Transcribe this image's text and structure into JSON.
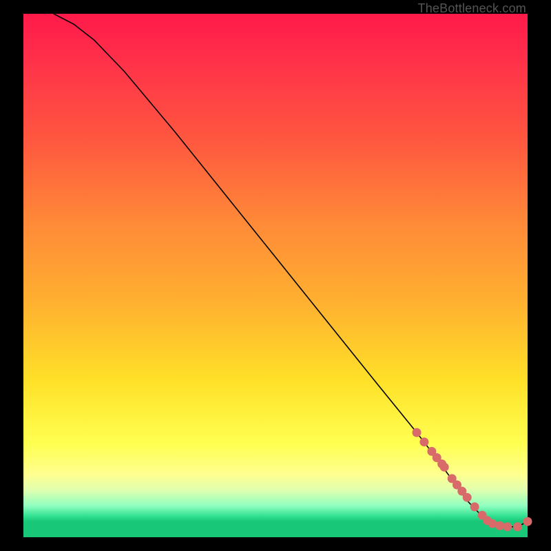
{
  "watermark": "TheBottleneck.com",
  "chart_data": {
    "type": "line",
    "title": "",
    "xlabel": "",
    "ylabel": "",
    "xlim": [
      0,
      100
    ],
    "ylim": [
      0,
      100
    ],
    "series": [
      {
        "name": "curve",
        "x": [
          6,
          10,
          14,
          20,
          30,
          40,
          50,
          60,
          70,
          78,
          82,
          85,
          88,
          92,
          95,
          98,
          100
        ],
        "y": [
          100,
          98,
          95,
          89,
          77.5,
          65.5,
          53.5,
          41.5,
          29.5,
          20,
          15,
          11,
          7,
          3,
          2,
          2,
          3
        ]
      }
    ],
    "highlight_points": {
      "name": "dots",
      "color": "#d86a6a",
      "x": [
        78,
        79.5,
        81,
        82,
        83,
        83.5,
        85,
        86,
        87,
        88,
        89.5,
        91,
        92,
        93,
        94.5,
        96,
        98,
        100
      ],
      "y": [
        20,
        18.2,
        16.4,
        15.2,
        14,
        13.4,
        11.2,
        10,
        8.8,
        7.6,
        5.8,
        4.2,
        3.2,
        2.6,
        2.2,
        2,
        2,
        3
      ]
    }
  }
}
